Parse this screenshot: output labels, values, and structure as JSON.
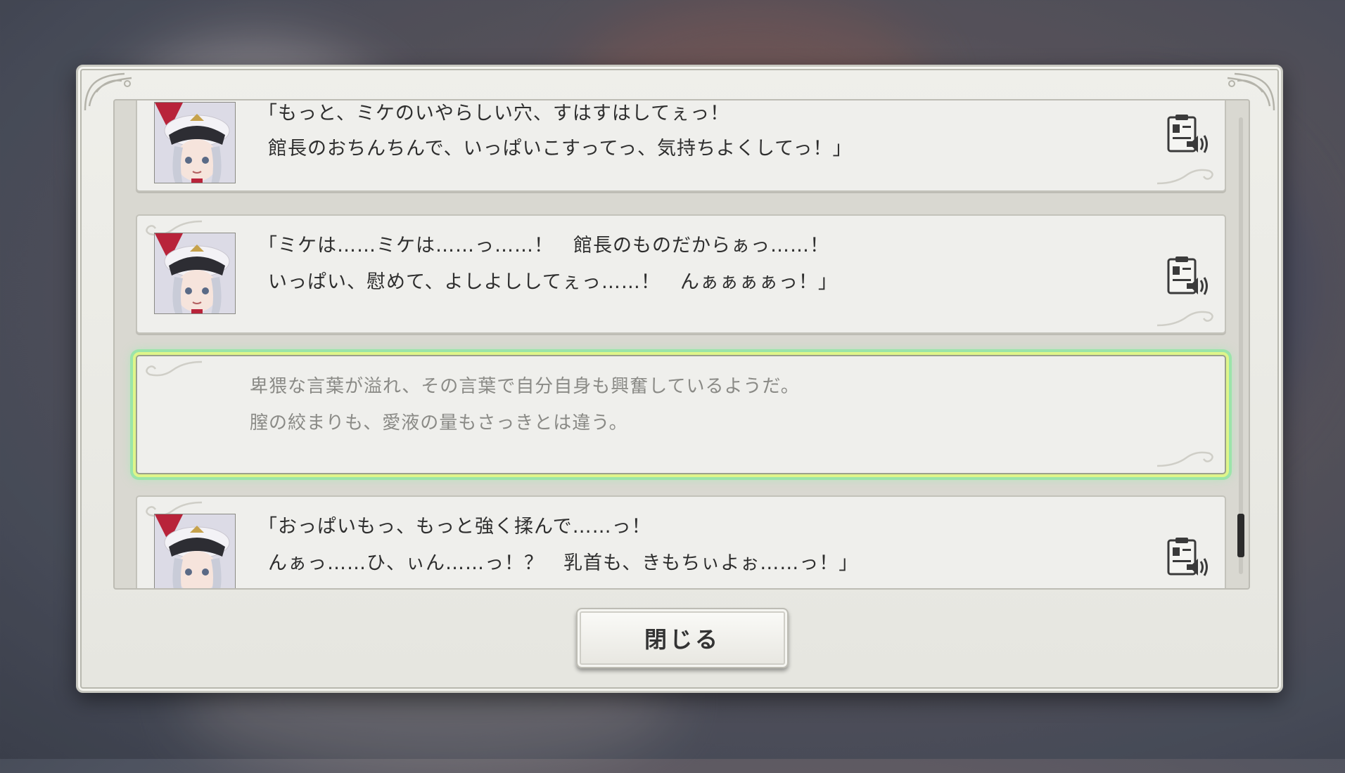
{
  "log": {
    "entries": [
      {
        "type": "speech",
        "speaker_portrait": "miike-portrait",
        "lines": [
          "「もっと、ミケのいやらしい穴、すはすはしてぇっ！",
          "館長のおちんちんで、いっぱいこすってっ、気持ちよくしてっ！」"
        ],
        "voice_icon": "voice-replay-icon"
      },
      {
        "type": "speech",
        "speaker_portrait": "miike-portrait",
        "lines": [
          "「ミケは……ミケは……っ……！　館長のものだからぁっ……！",
          "いっぱい、慰めて、よしよししてぇっ……！　んぁぁぁぁっ！」"
        ],
        "voice_icon": "voice-replay-icon"
      },
      {
        "type": "narration",
        "lines": [
          "卑猥な言葉が溢れ、その言葉で自分自身も興奮しているようだ。",
          "膣の絞まりも、愛液の量もさっきとは違う。"
        ],
        "highlighted": true
      },
      {
        "type": "speech",
        "speaker_portrait": "miike-portrait",
        "lines": [
          "「おっぱいもっ、もっと強く揉んで……っ！",
          "んぁっ……ひ、ぃん……っ！？　乳首も、きもちぃよぉ……っ！」"
        ],
        "voice_icon": "voice-replay-icon"
      }
    ]
  },
  "close_button": {
    "label": "閉じる"
  }
}
